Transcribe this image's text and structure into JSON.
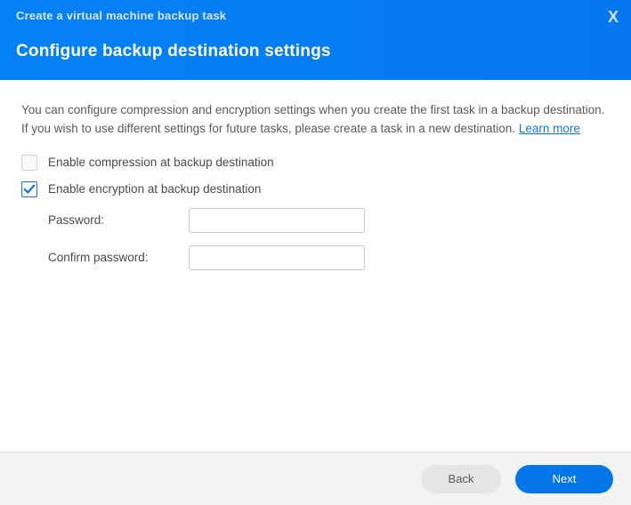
{
  "header": {
    "top_title": "Create a virtual machine backup task",
    "title": "Configure backup destination settings",
    "close": "X"
  },
  "description": {
    "text": "You can configure compression and encryption settings when you create the first task in a backup destination. If you wish to use different settings for future tasks, please create a task in a new destination. ",
    "learn_more": "Learn more"
  },
  "options": {
    "compression": {
      "label": "Enable compression at backup destination",
      "checked": false
    },
    "encryption": {
      "label": "Enable encryption at backup destination",
      "checked": true
    }
  },
  "form": {
    "password_label": "Password:",
    "confirm_password_label": "Confirm password:"
  },
  "footer": {
    "back": "Back",
    "next": "Next"
  }
}
